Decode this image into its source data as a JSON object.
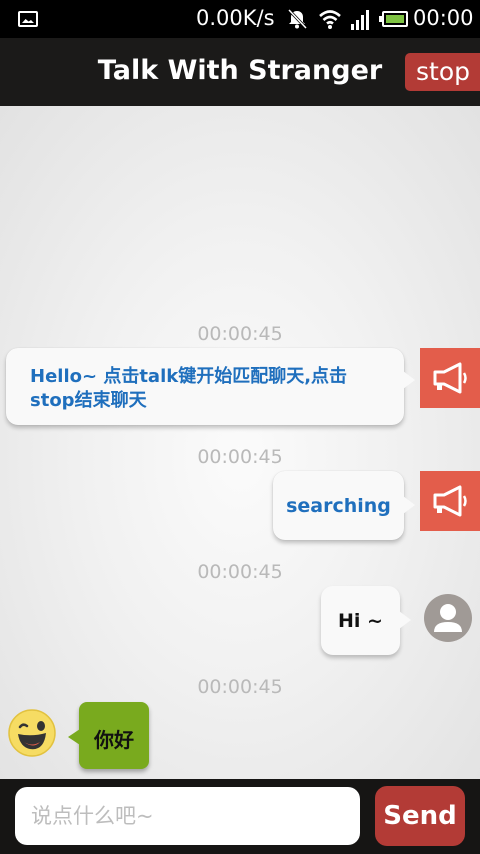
{
  "status_bar": {
    "network_speed": "0.00K/s",
    "time": "00:00",
    "icons": [
      "image-icon",
      "mute-icon",
      "wifi-icon",
      "signal-icon",
      "battery-icon"
    ]
  },
  "header": {
    "title": "Talk With Stranger",
    "stop_label": "stop"
  },
  "messages": [
    {
      "time": "00:00:45",
      "side": "right",
      "sender": "system",
      "text": "Hello~ 点击talk键开始匹配聊天,点击stop结束聊天",
      "lines": [
        "Hello~ 点击talk键开始匹配聊天,点击",
        "stop结束聊天"
      ],
      "avatar_icon": "megaphone-icon"
    },
    {
      "time": "00:00:45",
      "side": "right",
      "sender": "system",
      "text": "searching",
      "avatar_icon": "megaphone-icon"
    },
    {
      "time": "00:00:45",
      "side": "right",
      "sender": "me",
      "text": "Hi ~",
      "avatar_icon": "user-icon"
    },
    {
      "time": "00:00:45",
      "side": "left",
      "sender": "stranger",
      "text": "你好",
      "avatar_icon": "smiley-icon"
    }
  ],
  "composer": {
    "placeholder": "说点什么吧~",
    "value": "",
    "send_label": "Send"
  },
  "colors": {
    "accent_red": "#b33b36",
    "system_avatar": "#e35d4b",
    "system_text": "#1f6fbd",
    "stranger_bubble": "#79aa1e"
  }
}
